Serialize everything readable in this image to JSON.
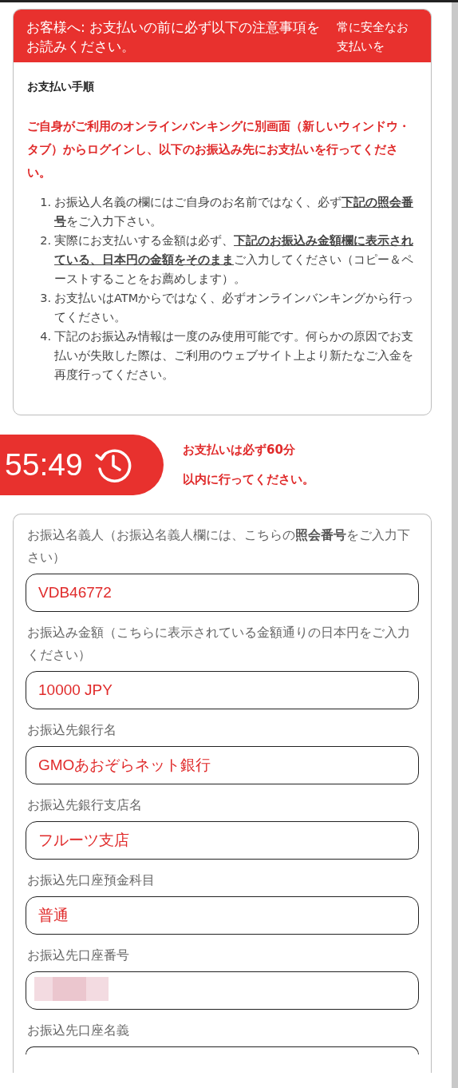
{
  "notice": {
    "title": "お客様へ: お支払いの前に必ず以下の注意事項をお読みください。",
    "side_text": "常に安全なお支払いを",
    "heading": "お支払い手順",
    "warning": "ご自身がご利用のオンラインバンキングに別画面（新しいウィンドウ・タブ）からログインし、以下のお振込み先にお支払いを行ってください。",
    "steps": [
      {
        "number": "1.",
        "text": "お振込人名義の欄にはご自身のお名前ではなく、必ず**下記の照会番号**をご入力下さい。"
      },
      {
        "number": "2.",
        "text": "実際にお支払いする金額は必ず、**下記のお振込み金額欄に表示されている、日本円の金額をそのまま**ご入力してください（コピー＆ペーストすることをお薦めします）。"
      },
      {
        "number": "3.",
        "text": "お支払いはATMからではなく、必ずオンラインバンキングから行ってください。"
      },
      {
        "number": "4.",
        "text": "下記のお振込み情報は一度のみ使用可能です。何らかの原因でお支払いが失敗した際は、ご利用のウェブサイト上より新たなご入金を再度行ってください。"
      }
    ]
  },
  "timer": {
    "time": "55:49",
    "message_lines": [
      "お支払いは必ず60分",
      "以内に行ってください。"
    ]
  },
  "fields": [
    {
      "label": "お振込名義人（お振込名義人欄には、こちらの**照会番号**をご入力下さい）",
      "kind": "text",
      "value": "VDB46772"
    },
    {
      "label": "お振込み金額（こちらに表示されている金額通りの日本円をご入力ください）",
      "kind": "text",
      "value": "10000 JPY"
    },
    {
      "label": "お振込先銀行名",
      "kind": "text",
      "value": "GMOあおぞらネット銀行"
    },
    {
      "label": "お振込先銀行支店名",
      "kind": "text",
      "value": "フルーツ支店"
    },
    {
      "label": "お振込先口座預金科目",
      "kind": "text",
      "value": "普通"
    },
    {
      "label": "お振込先口座番号",
      "kind": "masked"
    },
    {
      "label": "お振込先口座名義",
      "kind": "cut"
    }
  ]
}
